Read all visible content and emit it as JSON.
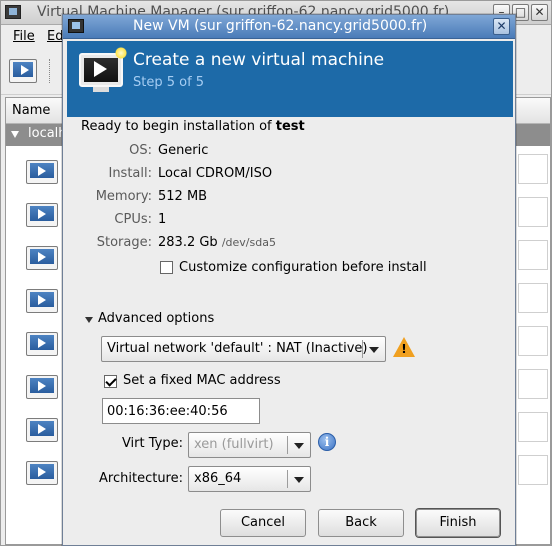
{
  "main_window": {
    "title": "Virtual Machine Manager (sur griffon-62.nancy.grid5000.fr)",
    "menu": [
      "File",
      "Ed"
    ],
    "list_header": "Name",
    "group_label": "localh",
    "window_controls": [
      "–",
      "□",
      "✕"
    ]
  },
  "dialog": {
    "title": "New VM (sur griffon-62.nancy.grid5000.fr)",
    "close_glyph": "✕",
    "banner": {
      "title": "Create a new virtual machine",
      "step": "Step 5 of 5"
    },
    "ready_prefix": "Ready to begin installation of",
    "vm_name": "test",
    "summary": {
      "os_label": "OS:",
      "os_value": "Generic",
      "install_label": "Install:",
      "install_value": "Local CDROM/ISO",
      "memory_label": "Memory:",
      "memory_value": "512 MB",
      "cpus_label": "CPUs:",
      "cpus_value": "1",
      "storage_label": "Storage:",
      "storage_value": "283.2 Gb",
      "storage_path": "/dev/sda5"
    },
    "customize_label": "Customize configuration before install",
    "customize_checked": false,
    "advanced_label": "Advanced options",
    "network_value": "Virtual network 'default' : NAT (Inactive)",
    "fixed_mac_label": "Set a fixed MAC address",
    "fixed_mac_checked": true,
    "mac_value": "00:16:36:ee:40:56",
    "virt_type_label": "Virt Type:",
    "virt_type_value": "xen (fullvirt)",
    "arch_label": "Architecture:",
    "arch_value": "x86_64",
    "buttons": {
      "cancel": "Cancel",
      "back": "Back",
      "finish": "Finish"
    },
    "warning_glyph": "!",
    "info_glyph": "i"
  },
  "icons": {
    "warning": "warning-icon",
    "info": "info-icon",
    "vm": "monitor-icon"
  }
}
